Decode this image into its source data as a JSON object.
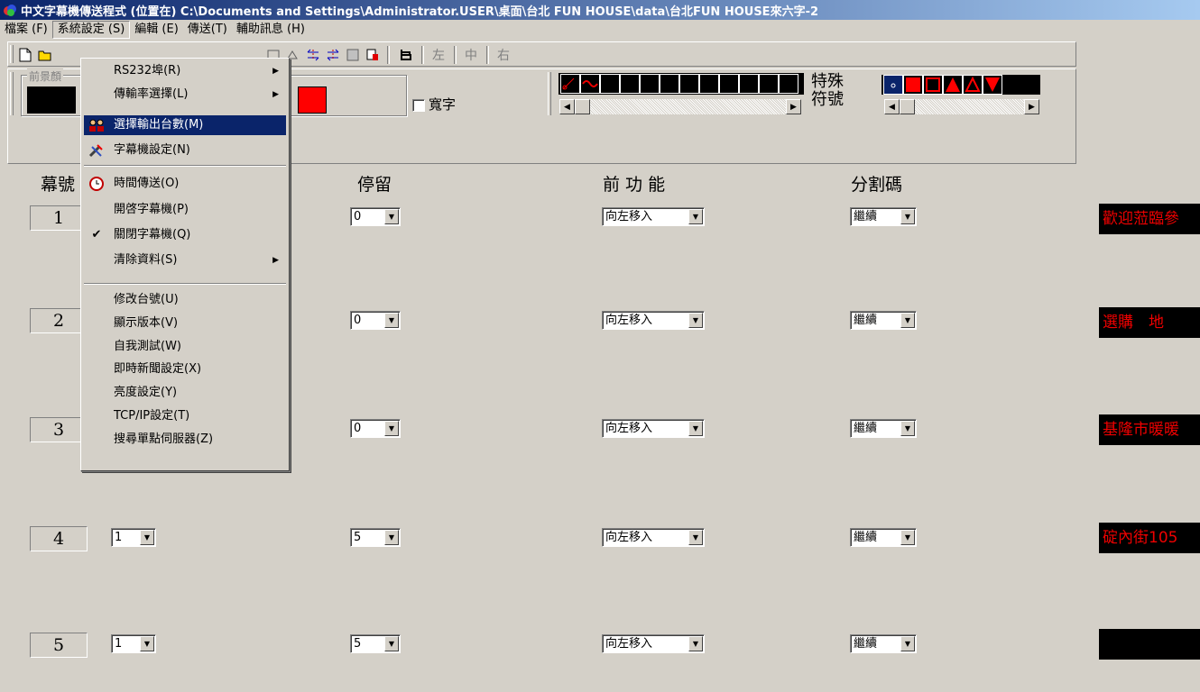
{
  "window": {
    "title": "中文字幕機傳送程式 (位置在) C:\\Documents and Settings\\Administrator.USER\\桌面\\台北 FUN HOUSE\\data\\台北FUN HOUSE來六字-2"
  },
  "menubar": [
    {
      "label": "檔案 (F)"
    },
    {
      "label": "系統設定 (S)"
    },
    {
      "label": "編輯 (E)"
    },
    {
      "label": "傳送(T)"
    },
    {
      "label": "輔助訊息 (H)"
    }
  ],
  "toolbar": {
    "align_labels": [
      "左",
      "中",
      "右"
    ],
    "fg_group_label": "前景顏",
    "wide_char_label": "寬字",
    "special_label_1": "特殊",
    "special_label_2": "符號"
  },
  "columns": {
    "screen_no": "幕號",
    "stay": "停留",
    "pre_function": "前 功 能",
    "split_code": "分割碼"
  },
  "rows": [
    {
      "num": "1",
      "speed": "",
      "stay": "0",
      "func": "向左移入",
      "split": "繼續",
      "preview": "歡迎蒞臨參"
    },
    {
      "num": "2",
      "speed": "",
      "stay": "0",
      "func": "向左移入",
      "split": "繼續",
      "preview": "選購　地"
    },
    {
      "num": "3",
      "speed": "",
      "stay": "0",
      "func": "向左移入",
      "split": "繼續",
      "preview": "基隆市暖暖"
    },
    {
      "num": "4",
      "speed": "1",
      "stay": "5",
      "func": "向左移入",
      "split": "繼續",
      "preview": "碇內街105"
    },
    {
      "num": "5",
      "speed": "1",
      "stay": "5",
      "func": "向左移入",
      "split": "繼續",
      "preview": ""
    }
  ],
  "dropdown": {
    "items": [
      {
        "label": "RS232埠(R)",
        "submenu": true
      },
      {
        "label": "傳輸率選擇(L)",
        "submenu": true
      },
      {
        "label": "選擇輸出台數(M)",
        "highlighted": true
      },
      {
        "label": "字幕機設定(N)"
      },
      {
        "label": "時間傳送(O)"
      },
      {
        "label": "開啓字幕機(P)"
      },
      {
        "label": "關閉字幕機(Q)",
        "checked": true
      },
      {
        "label": "清除資料(S)",
        "submenu": true
      },
      {
        "label": "修改台號(U)"
      },
      {
        "label": "顯示版本(V)"
      },
      {
        "label": "自我測試(W)"
      },
      {
        "label": "即時新聞設定(X)"
      },
      {
        "label": "亮度設定(Y)"
      },
      {
        "label": "TCP/IP設定(T)"
      },
      {
        "label": "搜尋單點伺服器(Z)"
      }
    ]
  },
  "colors": {
    "title_gradient_start": "#0a246a",
    "title_gradient_end": "#a6caf0",
    "led_text": "#ee0000",
    "swatch_red": "#ff0000"
  }
}
